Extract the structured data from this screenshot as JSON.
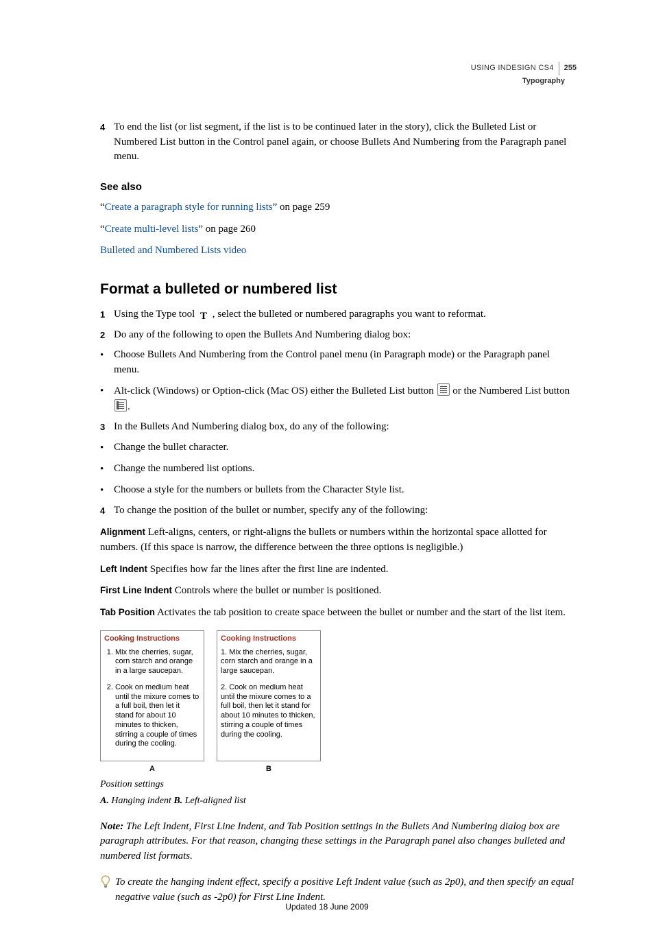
{
  "header": {
    "product": "USING INDESIGN CS4",
    "page": "255",
    "section": "Typography"
  },
  "step4": {
    "num": "4",
    "text": "To end the list (or list segment, if the list is to be continued later in the story), click the Bulleted List or Numbered List button in the Control panel again, or choose Bullets And Numbering from the Paragraph panel menu."
  },
  "seeAlso": {
    "title": "See also",
    "links": [
      {
        "pre": "“",
        "link": "Create a paragraph style for running lists",
        "post": "” on page 259"
      },
      {
        "pre": "“",
        "link": "Create multi-level lists",
        "post": "” on page 260"
      },
      {
        "pre": "",
        "link": "Bulleted and Numbered Lists video",
        "post": ""
      }
    ]
  },
  "h2": "Format a bulleted or numbered list",
  "steps": {
    "s1": {
      "num": "1",
      "a": "Using the Type tool ",
      "b": " , select the bulleted or numbered paragraphs you want to reformat."
    },
    "s2": {
      "num": "2",
      "text": "Do any of the following to open the Bullets And Numbering dialog box:"
    },
    "b1": "Choose Bullets And Numbering from the Control panel menu (in Paragraph mode) or the Paragraph panel menu.",
    "b2a": "Alt-click (Windows) or Option-click (Mac OS) either the Bulleted List button ",
    "b2b": " or the Numbered List button ",
    "b2c": ".",
    "s3": {
      "num": "3",
      "text": "In the Bullets And Numbering dialog box, do any of the following:"
    },
    "b3": "Change the bullet character.",
    "b4": "Change the numbered list options.",
    "b5": "Choose a style for the numbers or bullets from the Character Style list.",
    "s4": {
      "num": "4",
      "text": "To change the position of the bullet or number, specify any of the following:"
    }
  },
  "defs": {
    "alignment": {
      "term": "Alignment",
      "text": "Left-aligns, centers, or right-aligns the bullets or numbers within the horizontal space allotted for numbers. (If this space is narrow, the difference between the three options is negligible.)"
    },
    "leftIndent": {
      "term": "Left Indent",
      "text": "Specifies how far the lines after the first line are indented."
    },
    "firstLine": {
      "term": "First Line Indent",
      "text": "Controls where the bullet or number is positioned."
    },
    "tabPos": {
      "term": "Tab Position",
      "text": "Activates the tab position to create space between the bullet or number and the start of the list item."
    }
  },
  "figure": {
    "panelTitle": "Cooking Instructions",
    "li1": "Mix the cherries, sugar, corn starch and orange in a large saucepan.",
    "li2": "Cook on medium heat until the mixure comes to a full boil, then let it stand for about 10 minutes to thicken, stirring a couple of times during the cooling.",
    "labelA": "A",
    "labelB": "B",
    "caption": "Position settings",
    "keyA": "A.",
    "keyAtext": " Hanging indent  ",
    "keyB": "B.",
    "keyBtext": " Left-aligned list"
  },
  "note": {
    "label": "Note:",
    "text": " The Left Indent, First Line Indent, and Tab Position settings in the Bullets And Numbering dialog box are paragraph attributes. For that reason, changing these settings in the Paragraph panel also changes bulleted and numbered list formats."
  },
  "tip": "To create the hanging indent effect, specify a positive Left Indent value (such as 2p0), and then specify an equal negative value (such as -2p0) for First Line Indent.",
  "footer": "Updated 18 June 2009"
}
